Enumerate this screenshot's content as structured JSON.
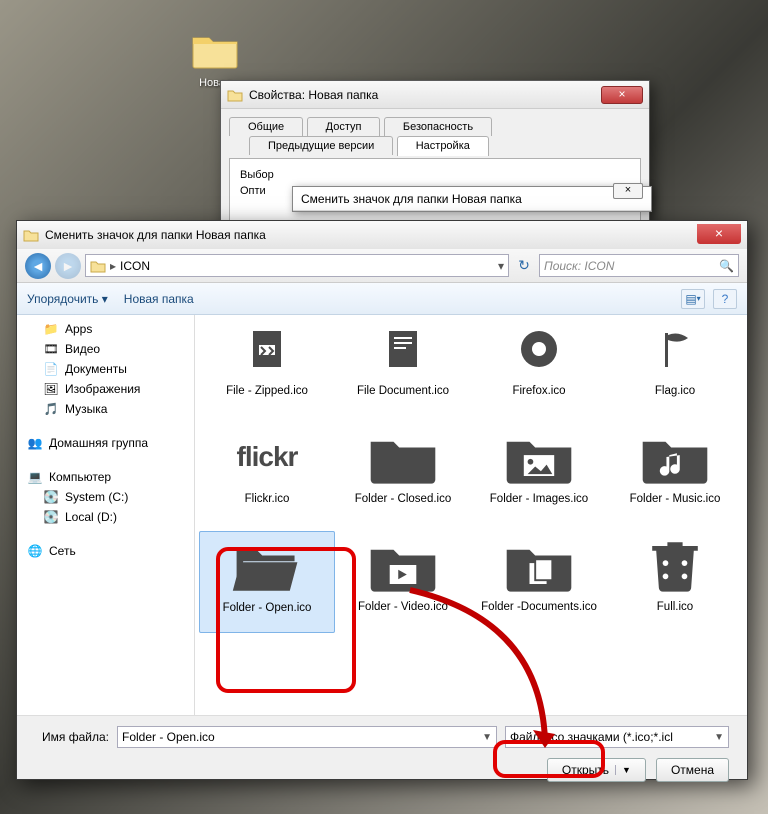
{
  "desktop": {
    "folder_label": "Новая"
  },
  "props": {
    "title": "Свойства: Новая папка",
    "tabs": {
      "general": "Общие",
      "sharing": "Доступ",
      "security": "Безопасность",
      "previous": "Предыдущие версии",
      "customize": "Настройка"
    },
    "group_label": "Выбор",
    "optim": "Опти"
  },
  "tip": {
    "text": "Сменить значок для папки Новая папка",
    "close": "×"
  },
  "dialog": {
    "title": "Сменить значок для папки Новая папка",
    "close": "×",
    "path_root": "ICON",
    "search_placeholder": "Поиск: ICON",
    "organize": "Упорядочить",
    "new_folder": "Новая папка",
    "filename_label": "Имя файла:",
    "filename_value": "Folder - Open.ico",
    "filter_value": "Файлы со значками (*.ico;*.icl",
    "open": "Открыть",
    "cancel": "Отмена"
  },
  "sidebar": {
    "apps": "Apps",
    "video": "Видео",
    "docs": "Документы",
    "images": "Изображения",
    "music": "Музыка",
    "homegroup": "Домашняя группа",
    "computer": "Компьютер",
    "system_c": "System (C:)",
    "local_d": "Local (D:)",
    "network": "Сеть"
  },
  "files": {
    "row0": [
      "File - Zipped.ico",
      "File Document.ico",
      "Firefox.ico",
      "Flag.ico"
    ],
    "row1": [
      "Flickr.ico",
      "Folder - Closed.ico",
      "Folder - Images.ico",
      "Folder - Music.ico"
    ],
    "row2": [
      "Folder - Open.ico",
      "Folder - Video.ico",
      "Folder -Documents.ico",
      "Full.ico"
    ]
  },
  "flickr_text": "flickr"
}
